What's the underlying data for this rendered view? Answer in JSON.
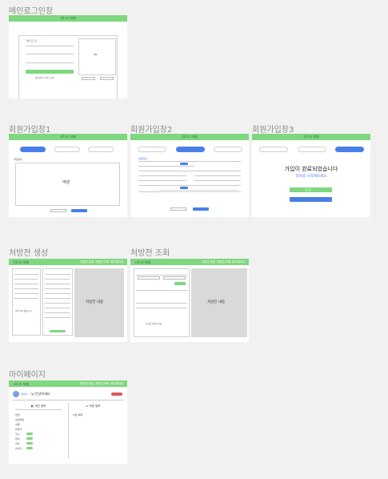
{
  "sections": {
    "main_login": "메인로그인창",
    "signup1": "회원가입창1",
    "signup2": "회원가입창2",
    "signup3": "회원가입창3",
    "prescription_create": "처방전 생성",
    "prescription_view": "처방전 조회",
    "mypage": "마이페이지"
  },
  "texts": {
    "logo": "(로고) 약제",
    "terms": "약관",
    "signup_complete": "가입이 완료되었습니다",
    "pharmacy_start": "약목을 시작해보세요",
    "prescription_content": "처방전 내용",
    "mypage_greeting": "님 안녕하세요",
    "login": "로그인",
    "nav_create": "처방전 생성",
    "nav_view": "처방전 조회",
    "nav_mypage": "마이페이지"
  },
  "colors": {
    "header_green": "#7fd77f",
    "button_blue": "#4a7fe8",
    "logout_red": "#e05656"
  }
}
